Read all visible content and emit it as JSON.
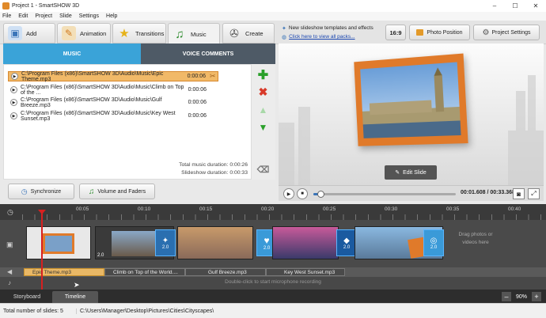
{
  "window": {
    "title": "Project 1 - SmartSHOW 3D",
    "minimize": "–",
    "maximize": "☐",
    "close": "✕"
  },
  "menu": [
    "File",
    "Edit",
    "Project",
    "Slide",
    "Settings",
    "Help"
  ],
  "tabs": [
    {
      "label": "Add",
      "icon": "add-photo-icon"
    },
    {
      "label": "Animation",
      "icon": "animation-icon"
    },
    {
      "label": "Transitions",
      "icon": "star-icon"
    },
    {
      "label": "Music",
      "icon": "music-note-icon"
    },
    {
      "label": "Create",
      "icon": "film-reel-icon"
    }
  ],
  "news": {
    "line1": "New slideshow templates and effects",
    "line2": "Click here to view all packs..."
  },
  "toolbar": {
    "ratio": "16:9",
    "photo_position": "Photo Position",
    "project_settings": "Project Settings"
  },
  "subtabs": {
    "music": "MUSIC",
    "voice": "VOICE COMMENTS"
  },
  "tracks": [
    {
      "path": "C:\\Program Files (x86)\\SmartSHOW 3D\\Audio\\Music\\Epic Theme.mp3",
      "duration": "0:00:06",
      "selected": true
    },
    {
      "path": "C:\\Program Files (x86)\\SmartSHOW 3D\\Audio\\Music\\Climb on Top of the ...",
      "duration": "0:00:06",
      "selected": false
    },
    {
      "path": "C:\\Program Files (x86)\\SmartSHOW 3D\\Audio\\Music\\Gulf Breeze.mp3",
      "duration": "0:00:06",
      "selected": false
    },
    {
      "path": "C:\\Program Files (x86)\\SmartSHOW 3D\\Audio\\Music\\Key West Sunset.mp3",
      "duration": "0:00:06",
      "selected": false
    }
  ],
  "durations": {
    "music": "Total music duration: 0:00:26",
    "slideshow": "Slideshow duration: 0:00:33"
  },
  "bottom_buttons": {
    "sync": "Synchronize",
    "volume": "Volume and Faders"
  },
  "preview": {
    "edit_slide": "Edit Slide"
  },
  "player": {
    "time": "00:01.608",
    "separator": " / ",
    "total": "00:33.368",
    "progress": 0.05
  },
  "ruler_ticks": [
    "00:05",
    "00:10",
    "00:15",
    "00:20",
    "00:25",
    "00:30",
    "00:35",
    "00:40"
  ],
  "slides": [
    "2.0",
    "2.0",
    "2.0",
    "2.0",
    "2.0"
  ],
  "drop_hint": "Drag photos or videos here",
  "audio_clips": [
    "Epic Theme.mp3",
    "Climb on Top of the World....",
    "Gulf Breeze.mp3",
    "Key West Sunset.mp3"
  ],
  "mic_hint": "Double-click to start microphone recording",
  "bottom_tabs": {
    "storyboard": "Storyboard",
    "timeline": "Timeline"
  },
  "status": {
    "slides": "Total number of slides: 5",
    "path": "C:\\Users\\Manager\\Desktop\\Pictures\\Cities\\Cityscapes\\"
  },
  "zoom": {
    "minus": "–",
    "value": "90%",
    "plus": "+"
  },
  "colors": {
    "accent": "#f1b968",
    "dark": "#4e5a66",
    "timeline_bg": "#3a3a3a",
    "transition": "#2a6fb0"
  }
}
